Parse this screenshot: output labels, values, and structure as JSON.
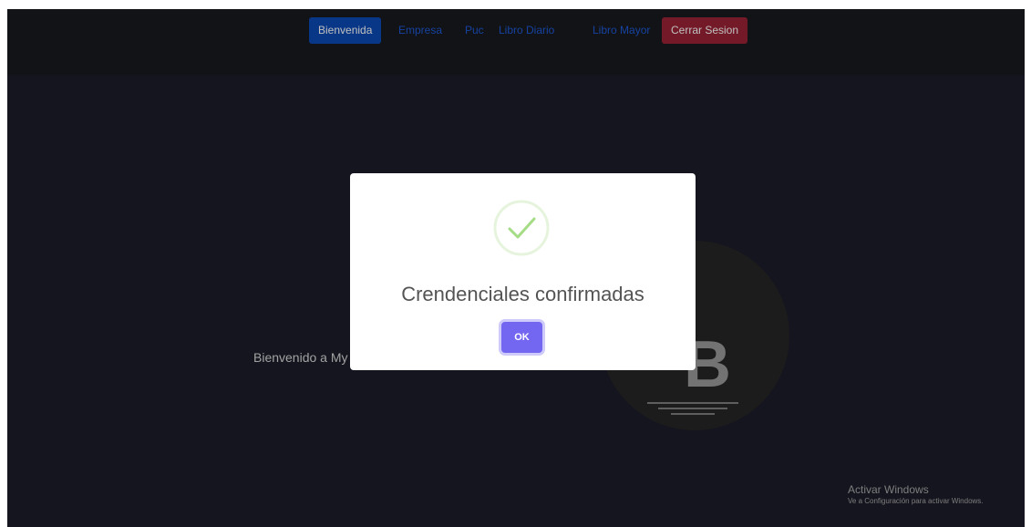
{
  "nav": {
    "items": [
      {
        "label": "Bienvenida",
        "style": "active"
      },
      {
        "label": "Empresa",
        "style": "link"
      },
      {
        "label": "Puc",
        "style": "link"
      },
      {
        "label": "Libro Diario",
        "style": "link"
      },
      {
        "label": "Libro Mayor",
        "style": "link"
      },
      {
        "label": "Cerrar Sesion",
        "style": "danger"
      }
    ]
  },
  "page": {
    "welcome_text": "Bienvenido a My",
    "logo_letter": "B"
  },
  "modal": {
    "icon": "checkmark-icon",
    "title": "Crendenciales confirmadas",
    "ok_label": "OK"
  },
  "watermark": {
    "title": "Activar Windows",
    "subtitle": "Ve a Configuración para activar Windows."
  },
  "colors": {
    "background": "#1b1c29",
    "nav_active": "#0c4ab5",
    "nav_danger": "#9b2234",
    "nav_link": "#1d59d6",
    "ok_button": "#7366f0",
    "success": "#a5dc86"
  }
}
